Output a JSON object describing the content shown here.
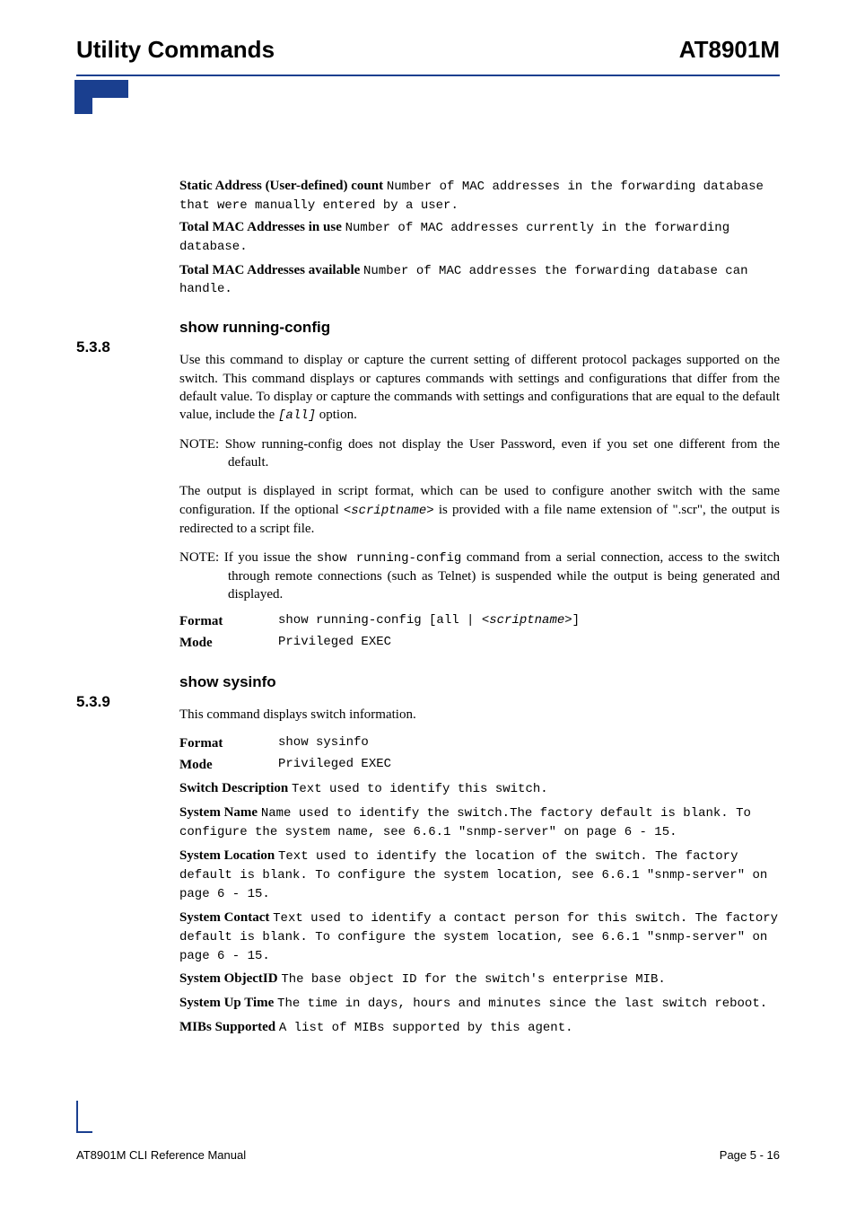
{
  "header": {
    "left": "Utility Commands",
    "right": "AT8901M"
  },
  "defs_top": [
    {
      "label": "Static Address (User-defined) count",
      "desc": "Number of MAC addresses in the forwarding database that were manually entered by a user."
    },
    {
      "label": "Total MAC Addresses in use",
      "desc": "Number of MAC addresses currently in the forwarding database."
    },
    {
      "label": "Total MAC Addresses available",
      "desc": "Number of MAC addresses the forwarding database can handle."
    }
  ],
  "s538": {
    "num": "5.3.8",
    "title": "show running-config",
    "para1_a": "Use this command to display or capture the current setting of different protocol packages supported on the switch. This command displays or captures commands with settings and configurations that differ from the default value. To display or capture the commands with settings and configurations that are equal to the default value, include the ",
    "para1_code": "[all]",
    "para1_b": " option.",
    "note1_lead": "NOTE:",
    "note1_body": " Show running-config does not display the User Password, even if you set one different from the default.",
    "para2_a": "The output is displayed in script format, which can be used to configure another switch with the same configuration. If the optional ",
    "para2_code": "<scriptname>",
    "para2_b": " is provided with a file name extension of \".scr\", the output is redirected to a script file.",
    "note2_lead": "NOTE:",
    "note2_a": " If you issue the ",
    "note2_code": "show running-config",
    "note2_b": " command from a serial connection, access to the switch through remote connections (such as Telnet) is suspended while the output is being generated and displayed.",
    "format_label": "Format",
    "format_val_a": "show running-config [all | ",
    "format_val_code": "<scriptname>",
    "format_val_b": "]",
    "mode_label": "Mode",
    "mode_val": "Privileged EXEC"
  },
  "s539": {
    "num": "5.3.9",
    "title": "show sysinfo",
    "intro": "This command displays switch information.",
    "format_label": "Format",
    "format_val": "show sysinfo",
    "mode_label": "Mode",
    "mode_val": "Privileged EXEC",
    "defs": [
      {
        "label": "Switch Description",
        "desc": "Text used to identify this switch."
      },
      {
        "label": "System Name",
        "desc_a": "Name used to identify the switch.The factory default is blank. To configure the system name, see ",
        "xref": "6.6.1 \"snmp-server\"  on page 6 - 15",
        "desc_b": "."
      },
      {
        "label": "System Location",
        "desc_a": "Text used to identify the location of the switch. The factory default is blank. To configure the system location, see ",
        "xref": "6.6.1 \"snmp-server\"  on page 6 - 15",
        "desc_b": "."
      },
      {
        "label": "System Contact",
        "desc_a": "Text used to identify a contact person for this switch. The factory default is blank. To configure the system location, see ",
        "xref": "6.6.1 \"snmp-server\"  on page 6 - 15",
        "desc_b": "."
      },
      {
        "label": "System ObjectID",
        "desc": "The base object ID for the switch's enterprise MIB."
      },
      {
        "label": "System Up Time",
        "desc": "The time in days, hours and minutes since the last switch reboot."
      },
      {
        "label": "MIBs Supported",
        "desc": "A list of MIBs supported by this agent."
      }
    ]
  },
  "footer": {
    "left": "AT8901M CLI Reference Manual",
    "right": "Page 5 - 16"
  }
}
